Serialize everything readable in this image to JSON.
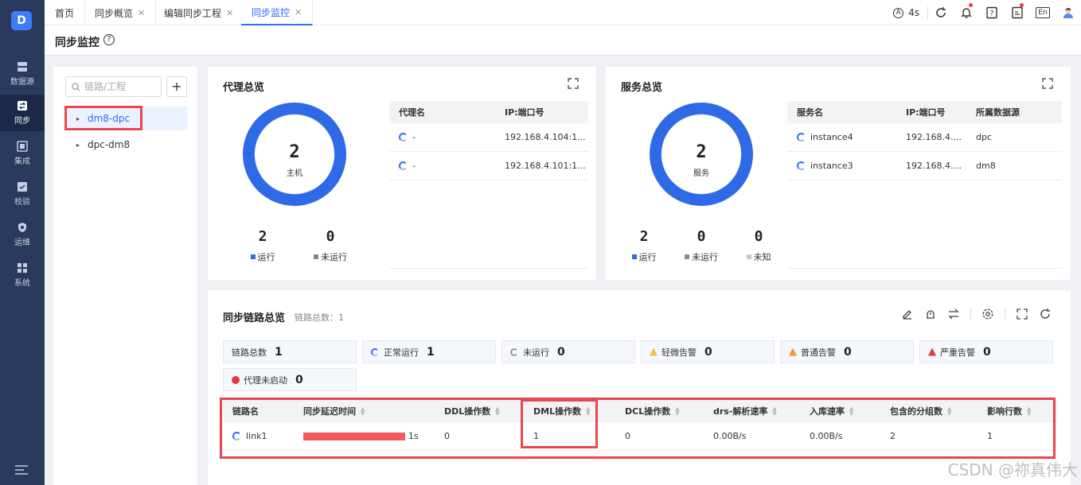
{
  "brand": {
    "logo_glyph": "D"
  },
  "nav": [
    {
      "label": "数据源",
      "icon": "server-icon"
    },
    {
      "label": "同步",
      "icon": "sync-icon",
      "active": true
    },
    {
      "label": "集成",
      "icon": "integration-icon"
    },
    {
      "label": "校验",
      "icon": "check-icon"
    },
    {
      "label": "运维",
      "icon": "ops-icon"
    },
    {
      "label": "系统",
      "icon": "grid-icon"
    }
  ],
  "tabs": [
    {
      "label": "首页",
      "closable": false
    },
    {
      "label": "同步概览",
      "closable": true
    },
    {
      "label": "编辑同步工程",
      "closable": true
    },
    {
      "label": "同步监控",
      "closable": true,
      "active": true
    }
  ],
  "tab_close_glyph": "✕",
  "topbar": {
    "auto_glyph": "A",
    "refresh_interval": "4s",
    "lang": "En"
  },
  "page": {
    "title": "同步监控",
    "help_glyph": "?"
  },
  "tree": {
    "search_placeholder": "链路/工程",
    "add_glyph": "+",
    "caret_glyph": "▸",
    "nodes": [
      {
        "label": "dm8-dpc",
        "selected": true
      },
      {
        "label": "dpc-dm8",
        "selected": false
      }
    ]
  },
  "agent_panel": {
    "title": "代理总览",
    "donut": {
      "value": "2",
      "label": "主机"
    },
    "stats": [
      {
        "value": "2",
        "label": "运行",
        "color": "#2e6ae6"
      },
      {
        "value": "0",
        "label": "未运行",
        "color": "#7f8aa0"
      }
    ],
    "table": {
      "headers": [
        "代理名",
        "IP:端口号"
      ],
      "rows": [
        [
          "-",
          "192.168.4.104:1..."
        ],
        [
          "-",
          "192.168.4.101:1..."
        ]
      ]
    }
  },
  "service_panel": {
    "title": "服务总览",
    "donut": {
      "value": "2",
      "label": "服务"
    },
    "stats": [
      {
        "value": "2",
        "label": "运行",
        "color": "#2e6ae6"
      },
      {
        "value": "0",
        "label": "未运行",
        "color": "#7f8aa0"
      },
      {
        "value": "0",
        "label": "未知",
        "color": "#c8c8c8"
      }
    ],
    "table": {
      "headers": [
        "服务名",
        "IP:端口号",
        "所属数据源"
      ],
      "rows": [
        [
          "instance4",
          "192.168.4....",
          "dpc"
        ],
        [
          "instance3",
          "192.168.4....",
          "dm8"
        ]
      ]
    }
  },
  "links_panel": {
    "title": "同步链路总览",
    "subtitle": "链路总数：1",
    "cards": [
      {
        "label": "链路总数",
        "value": "1",
        "icon": "none"
      },
      {
        "label": "正常运行",
        "value": "1",
        "icon": "running-icon"
      },
      {
        "label": "未运行",
        "value": "0",
        "icon": "stopped-icon"
      },
      {
        "label": "轻微告警",
        "value": "0",
        "icon": "minor-alarm-icon"
      },
      {
        "label": "普通告警",
        "value": "0",
        "icon": "normal-alarm-icon"
      },
      {
        "label": "严重告警",
        "value": "0",
        "icon": "critical-alarm-icon"
      },
      {
        "label": "代理未启动",
        "value": "0",
        "icon": "agent-error-icon"
      }
    ],
    "table": {
      "headers": [
        "链路名",
        "同步延迟时间",
        "DDL操作数",
        "DML操作数",
        "DCL操作数",
        "drs-解析速率",
        "入库速率",
        "包含的分组数",
        "影响行数"
      ],
      "rows": [
        {
          "name": "link1",
          "delay": "1s",
          "ddl": "0",
          "dml": "1",
          "dcl": "0",
          "parse_rate": "0.00B/s",
          "load_rate": "0.00B/s",
          "groups": "2",
          "rows": "1"
        }
      ]
    }
  },
  "colors": {
    "accent": "#2f6bff",
    "sidebar": "#2a3a5c",
    "highlight": "#e9474f",
    "delay_bar": "#f15a5e"
  },
  "watermark": "CSDN @祢真伟大"
}
